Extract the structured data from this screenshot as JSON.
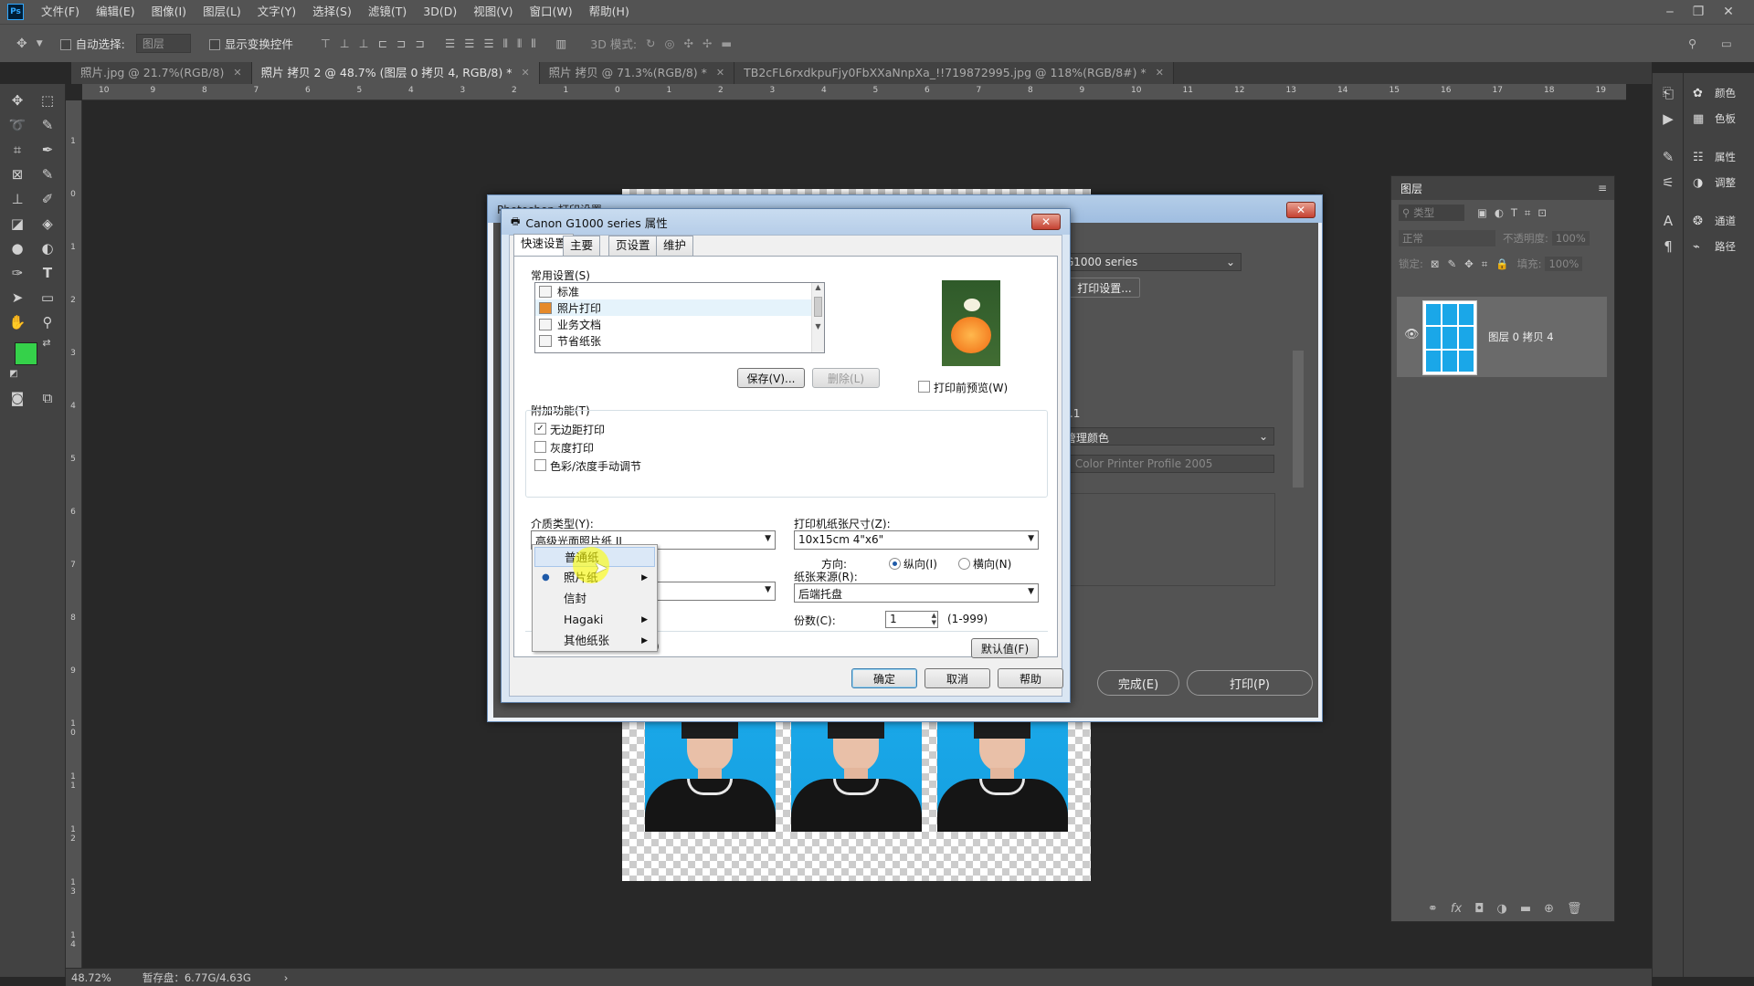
{
  "app": {
    "logo": "Ps"
  },
  "menubar": {
    "items": [
      "文件(F)",
      "编辑(E)",
      "图像(I)",
      "图层(L)",
      "文字(Y)",
      "选择(S)",
      "滤镜(T)",
      "3D(D)",
      "视图(V)",
      "窗口(W)",
      "帮助(H)"
    ]
  },
  "optionsbar": {
    "auto_select_label": "自动选择:",
    "auto_select_value": "图层",
    "show_transform_label": "显示变换控件",
    "mode3d_label": "3D 模式:"
  },
  "doctabs": [
    {
      "label": "照片.jpg @ 21.7%(RGB/8)",
      "active": false
    },
    {
      "label": "照片 拷贝 2 @ 48.7% (图层 0 拷贝 4, RGB/8) *",
      "active": true
    },
    {
      "label": "照片 拷贝 @ 71.3%(RGB/8) *",
      "active": false
    },
    {
      "label": "TB2cFL6rxdkpuFjy0FbXXaNnpXa_!!719872995.jpg @ 118%(RGB/8#) *",
      "active": false
    }
  ],
  "ruler_top": [
    "10",
    "9",
    "8",
    "7",
    "6",
    "5",
    "4",
    "3",
    "2",
    "1",
    "0",
    "1",
    "2",
    "3",
    "4",
    "5",
    "6",
    "7",
    "8",
    "9",
    "10",
    "11",
    "12",
    "13",
    "14",
    "15",
    "16",
    "17",
    "18",
    "19",
    "20"
  ],
  "ruler_left": [
    "1",
    "0",
    "1",
    "2",
    "3",
    "4",
    "5",
    "6",
    "7",
    "8",
    "9",
    "1 0",
    "1 1",
    "1 2",
    "1 3",
    "1 4"
  ],
  "right_panels": {
    "color": "颜色",
    "swatches": "色板",
    "properties": "属性",
    "adjustments": "调整",
    "channels": "通道",
    "paths": "路径"
  },
  "layers_panel": {
    "title": "图层",
    "kind_placeholder": "类型",
    "blend_mode": "正常",
    "opacity_label": "不透明度:",
    "opacity_value": "100%",
    "lock_label": "锁定:",
    "fill_label": "填充:",
    "fill_value": "100%",
    "layer_name": "图层 0 拷贝 4"
  },
  "statusbar": {
    "zoom": "48.72%",
    "scratch": "暂存盘：6.77G/4.63G"
  },
  "print_dialog": {
    "title": "Photoshop 打印设置",
    "printer_value": "G1000 series",
    "print_settings_button": "打印设置...",
    "version_text": "-2.1",
    "color_handling": "管理颜色",
    "printer_profile": "IJ Color Printer Profile 2005",
    "done_button": "完成(E)",
    "print_button": "打印(P)"
  },
  "canon_dialog": {
    "title": "Canon G1000 series 属性",
    "tabs": [
      "快速设置",
      "主要",
      "页设置",
      "维护"
    ],
    "common_settings_label": "常用设置(S)",
    "common_settings_items": [
      "标准",
      "照片打印",
      "业务文档",
      "节省纸张"
    ],
    "selected_common_setting": 1,
    "save_button": "保存(V)...",
    "delete_button": "删除(L)",
    "preview_checkbox": "打印前预览(W)",
    "extra_features_label": "附加功能(T)",
    "extra_features": [
      {
        "label": "无边距打印",
        "checked": true
      },
      {
        "label": "灰度打印",
        "checked": false
      },
      {
        "label": "色彩/浓度手动调节",
        "checked": false
      }
    ],
    "media_type_label": "介质类型(Y):",
    "media_type_value": "高级光面照片纸 II",
    "paper_size_label": "打印机纸张尺寸(Z):",
    "paper_size_value": "10x15cm 4\"x6\"",
    "orientation_label": "方向:",
    "portrait_label": "纵向(I)",
    "landscape_label": "横向(N)",
    "paper_source_label": "纸张来源(R):",
    "paper_source_value": "后端托盘",
    "copies_label": "份数(C):",
    "copies_value": "1",
    "copies_range": "(1-999)",
    "defaults_button": "默认值(F)",
    "ok_button": "确定",
    "cancel_button": "取消",
    "help_button": "帮助",
    "partial_hidden_text": ")"
  },
  "media_menu": {
    "items": [
      {
        "label": "普通纸",
        "submenu": false,
        "highlighted": true,
        "checked": false
      },
      {
        "label": "照片纸",
        "submenu": true,
        "highlighted": false,
        "checked": true
      },
      {
        "label": "信封",
        "submenu": false,
        "highlighted": false,
        "checked": false
      },
      {
        "label": "Hagaki",
        "submenu": true,
        "highlighted": false,
        "checked": false
      },
      {
        "label": "其他纸张",
        "submenu": true,
        "highlighted": false,
        "checked": false
      }
    ]
  },
  "colors": {
    "accent": "#31a8ff",
    "foreground_color": "#35d14a",
    "background_color": "#ffffff"
  }
}
